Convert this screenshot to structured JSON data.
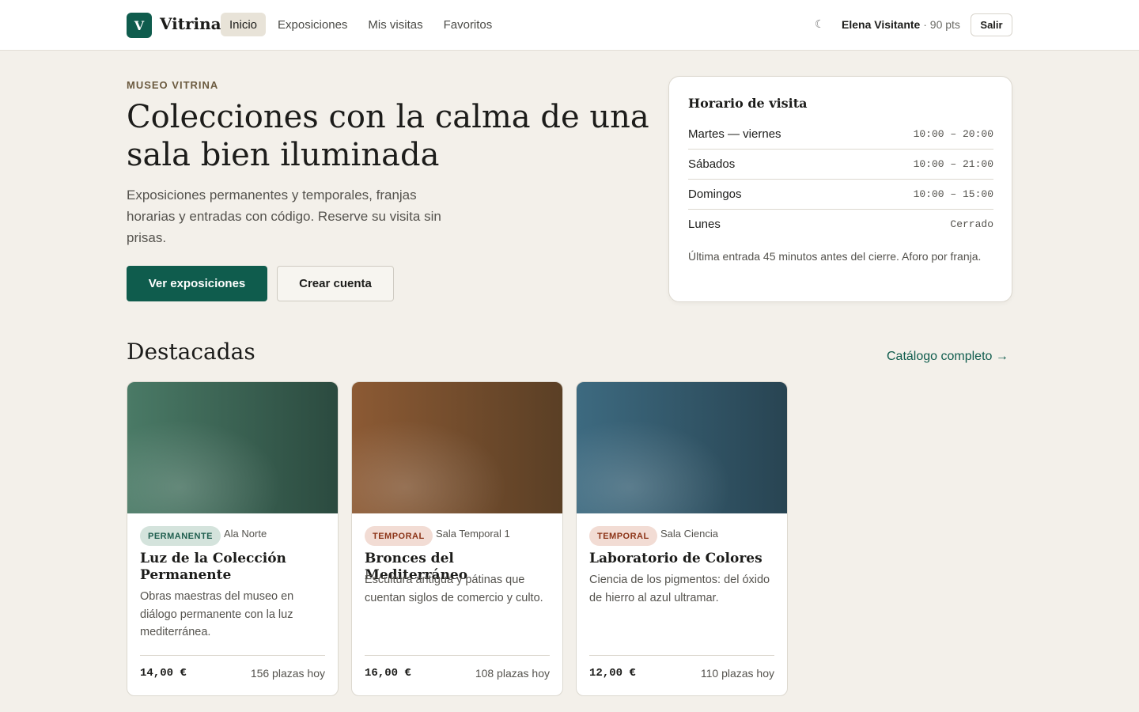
{
  "header": {
    "logo_letter": "V",
    "app_name": "Vitrina",
    "nav": [
      {
        "label": "Inicio",
        "active": true
      },
      {
        "label": "Exposiciones",
        "active": false
      },
      {
        "label": "Mis visitas",
        "active": false
      },
      {
        "label": "Favoritos",
        "active": false
      }
    ],
    "theme_icon": "☾",
    "user_name": "Elena Visitante",
    "user_points": "· 90 pts",
    "logout_label": "Salir"
  },
  "hero": {
    "eyebrow": "MUSEO VITRINA",
    "title": "Colecciones con la calma de una sala bien iluminada",
    "subtitle": "Exposiciones permanentes y temporales, franjas horarias y entradas con código. Reserve su visita sin prisas.",
    "primary_button": "Ver exposiciones",
    "secondary_button": "Crear cuenta"
  },
  "hours": {
    "title": "Horario de visita",
    "rows": [
      {
        "day": "Martes — viernes",
        "time": "10:00 – 20:00"
      },
      {
        "day": "Sábados",
        "time": "10:00 – 21:00"
      },
      {
        "day": "Domingos",
        "time": "10:00 – 15:00"
      },
      {
        "day": "Lunes",
        "time": "Cerrado"
      }
    ],
    "note": "Última entrada 45 minutos antes del cierre. Aforo por franja."
  },
  "featured": {
    "title": "Destacadas",
    "catalog_link": "Catálogo completo →",
    "cards": [
      {
        "badge": "PERMANENTE",
        "badge_type": "perm",
        "room": "Ala Norte",
        "title": "Luz de la Colección Permanente",
        "description": "Obras maestras del museo en diálogo permanente con la luz mediterránea.",
        "price": "14,00 €",
        "seats": "156 plazas hoy",
        "color_a": "#4a7a66",
        "color_b": "#2b4a3f"
      },
      {
        "badge": "TEMPORAL",
        "badge_type": "temp",
        "room": "Sala Temporal 1",
        "title": "Bronces del Mediterráneo",
        "description": "Escultura antigua y pátinas que cuentan siglos de comercio y culto.",
        "price": "16,00 €",
        "seats": "108 plazas hoy",
        "color_a": "#8c5a34",
        "color_b": "#5a3f25"
      },
      {
        "badge": "TEMPORAL",
        "badge_type": "temp",
        "room": "Sala Ciencia",
        "title": "Laboratorio de Colores",
        "description": "Ciencia de los pigmentos: del óxido de hierro al azul ultramar.",
        "price": "12,00 €",
        "seats": "110 plazas hoy",
        "color_a": "#3d6a80",
        "color_b": "#284452"
      }
    ]
  }
}
